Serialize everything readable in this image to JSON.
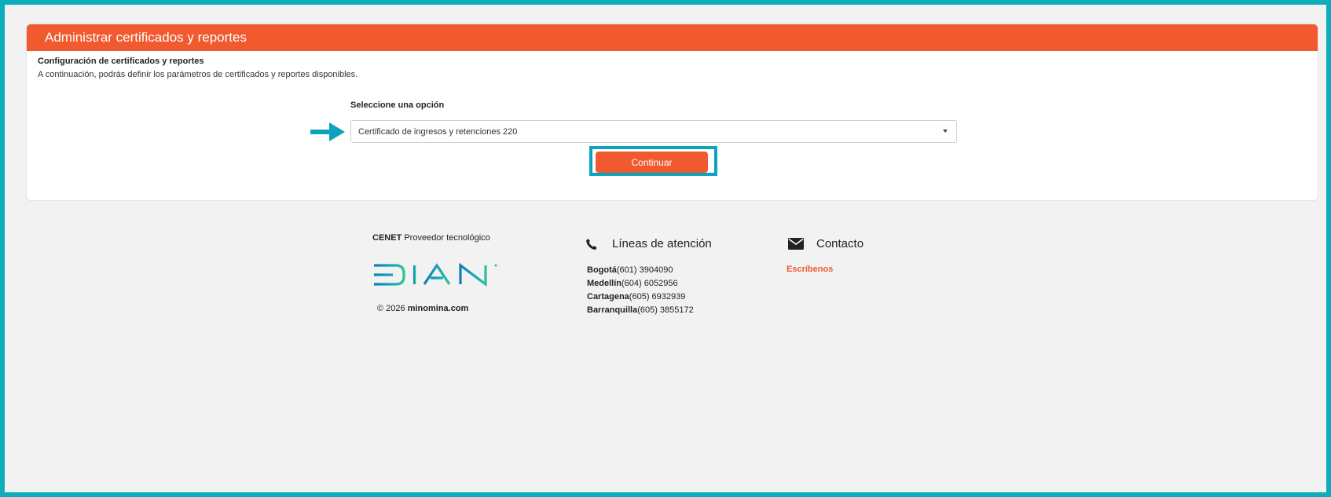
{
  "card": {
    "title": "Administrar certificados y reportes",
    "section_title": "Configuración de certificados y reportes",
    "section_desc": "A continuación, podrás definir los parámetros de certificados y reportes disponibles."
  },
  "form": {
    "select_label": "Seleccione una opción",
    "select_value": "Certificado de ingresos y retenciones 220",
    "continue_label": "Continuar"
  },
  "footer": {
    "cenet_bold": "CENET",
    "cenet_text": " Proveedor tecnológico",
    "logo_text": "DIAN",
    "copyright_prefix": "© 2026 ",
    "copyright_site": "minomina.com",
    "lines_heading": "Líneas de atención",
    "phones": [
      {
        "city": "Bogotá",
        "number": "(601) 3904090"
      },
      {
        "city": "Medellín",
        "number": "(604) 6052956"
      },
      {
        "city": "Cartagena",
        "number": "(605) 6932939"
      },
      {
        "city": "Barranquilla",
        "number": "(605) 3855172"
      }
    ],
    "contact_heading": "Contacto",
    "contact_link": "Escríbenos"
  },
  "colors": {
    "accent": "#f05a2e",
    "frame": "#0eadbc",
    "highlight": "#0ea3bd"
  },
  "icons": {
    "arrow": "arrow-right-icon",
    "phone": "phone-icon",
    "mail": "envelope-icon",
    "caret": "caret-down-icon"
  }
}
